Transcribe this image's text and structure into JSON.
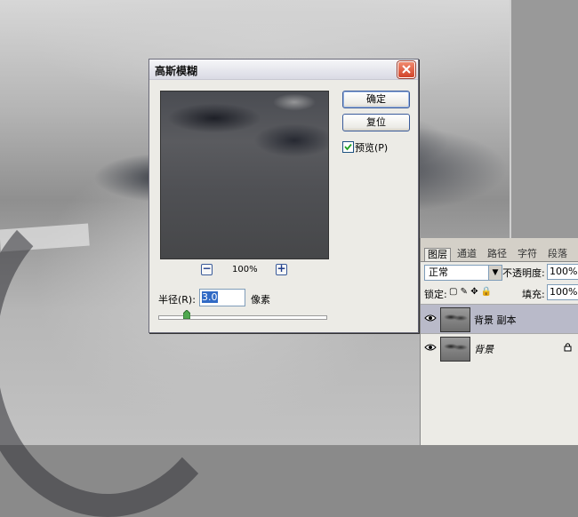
{
  "dialog": {
    "title": "高斯模糊",
    "ok_label": "确定",
    "reset_label": "复位",
    "preview_label": "预览(P)",
    "preview_checked": true,
    "zoom_minus": "−",
    "zoom_plus": "+",
    "zoom_value": "100%",
    "radius_label": "半径(R):",
    "radius_value": "3.0",
    "radius_unit": "像素"
  },
  "layers_panel": {
    "tabs": [
      "图层",
      "通道",
      "路径",
      "字符",
      "段落"
    ],
    "blend_mode": "正常",
    "opacity_label": "不透明度:",
    "opacity_value": "100%",
    "lock_label": "锁定:",
    "fill_label": "填充:",
    "fill_value": "100%",
    "layers": [
      {
        "name": "背景 副本",
        "selected": true
      },
      {
        "name": "背景",
        "selected": false,
        "locked": true
      }
    ]
  }
}
